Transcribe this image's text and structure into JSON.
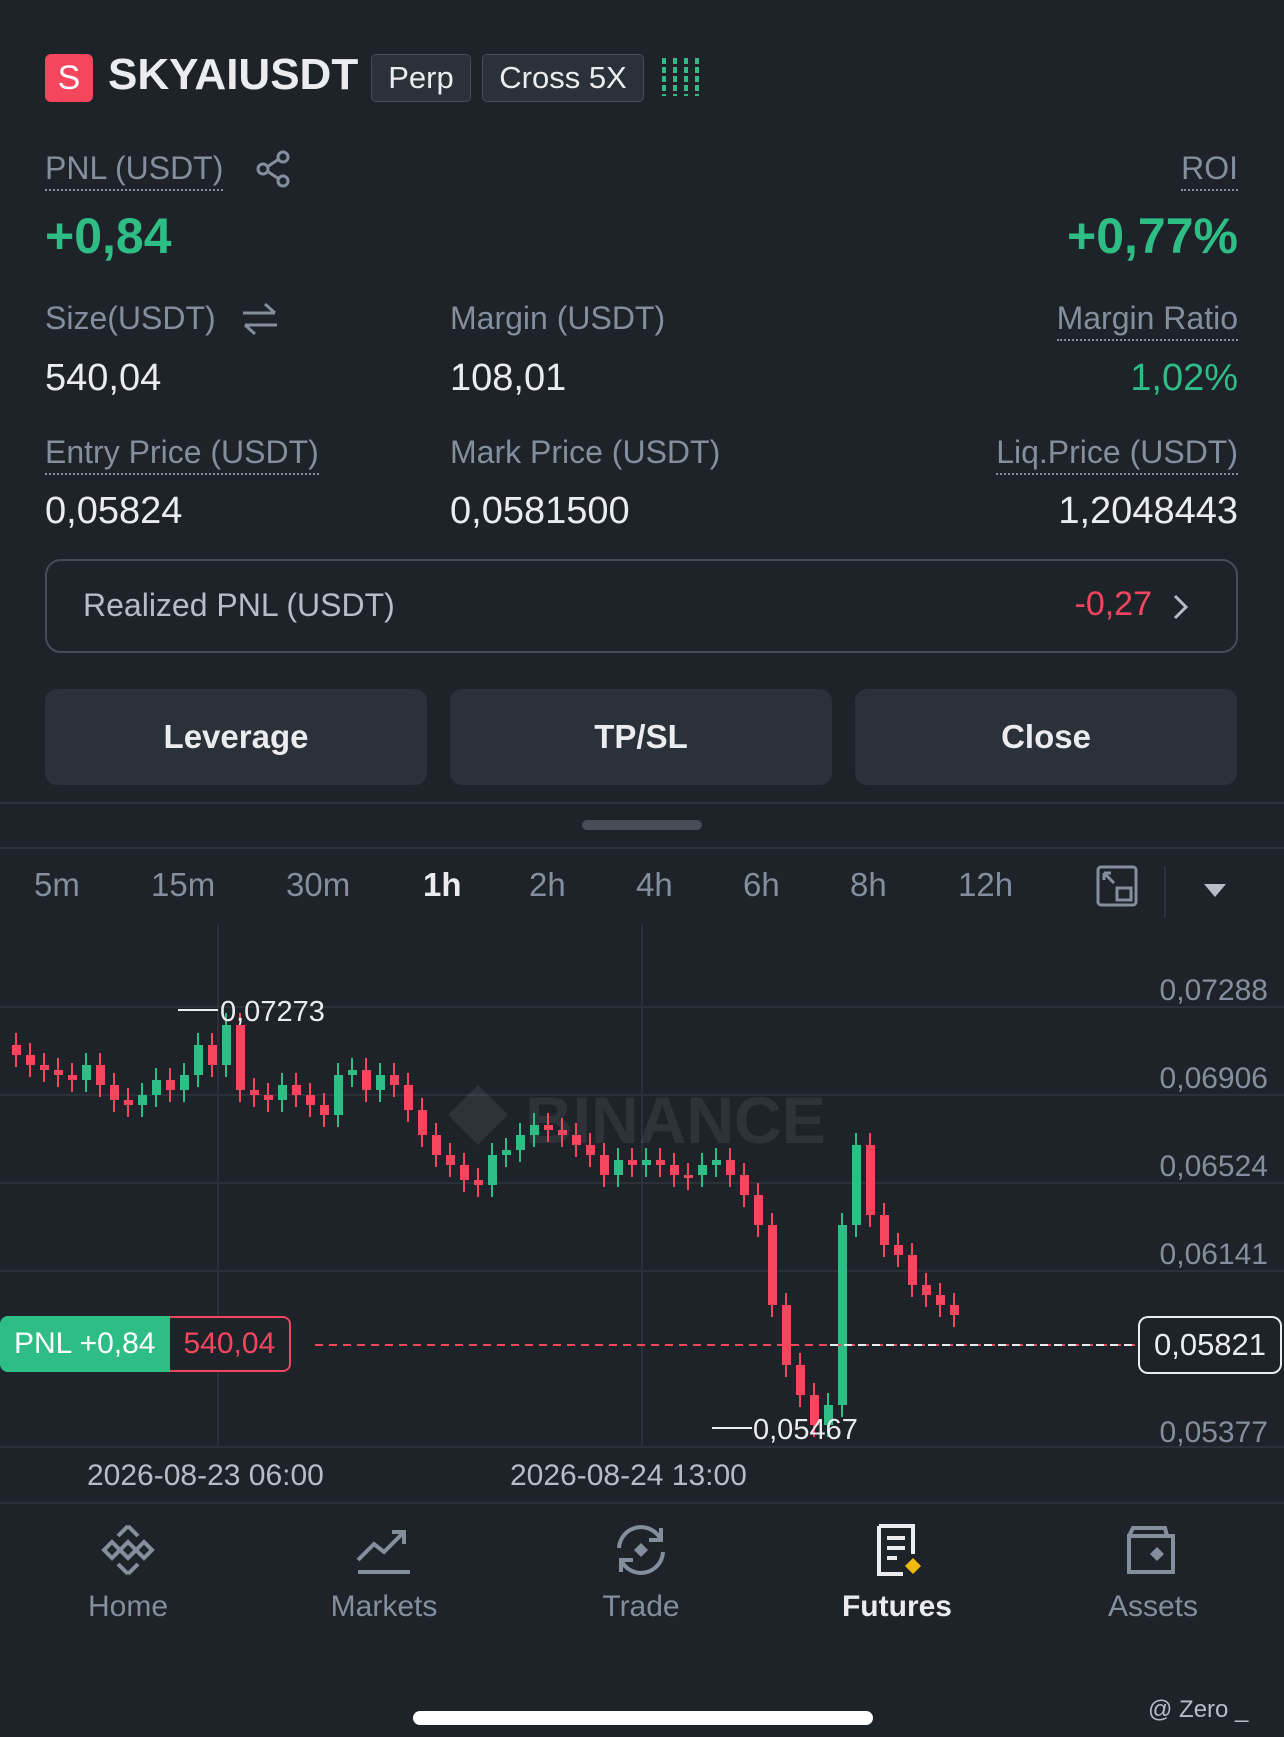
{
  "header": {
    "badge": "S",
    "symbol": "SKYAIUSDT",
    "tag_perp": "Perp",
    "tag_margin": "Cross 5X"
  },
  "pnl": {
    "label": "PNL (USDT)",
    "value": "+0,84"
  },
  "roi": {
    "label": "ROI",
    "value": "+0,77%"
  },
  "size": {
    "label": "Size(USDT)",
    "value": "540,04"
  },
  "margin": {
    "label": "Margin (USDT)",
    "value": "108,01"
  },
  "margin_ratio": {
    "label": "Margin Ratio",
    "value": "1,02%"
  },
  "entry_price": {
    "label": "Entry Price (USDT)",
    "value": "0,05824"
  },
  "mark_price": {
    "label": "Mark Price (USDT)",
    "value": "0,0581500"
  },
  "liq_price": {
    "label": "Liq.Price (USDT)",
    "value": "1,2048443"
  },
  "realized_pnl": {
    "label": "Realized PNL (USDT)",
    "value": "-0,27"
  },
  "actions": {
    "leverage": "Leverage",
    "tpsl": "TP/SL",
    "close": "Close"
  },
  "timeframes": [
    "5m",
    "15m",
    "30m",
    "1h",
    "2h",
    "4h",
    "6h",
    "8h",
    "12h"
  ],
  "active_timeframe": "1h",
  "chart": {
    "y_labels": [
      "0,07288",
      "0,06906",
      "0,06524",
      "0,06141",
      "0,05821",
      "0,05377"
    ],
    "x_labels": [
      "2026-08-23 06:00",
      "2026-08-24 13:00"
    ],
    "high_label": "0,07273",
    "low_label": "0,05467",
    "watermark": "BINANCE",
    "pnl_tag": "PNL +0,84",
    "size_tag": "540,04",
    "current_price": "0,05821"
  },
  "nav": [
    {
      "label": "Home",
      "icon": "binance-logo-icon"
    },
    {
      "label": "Markets",
      "icon": "chart-trend-icon"
    },
    {
      "label": "Trade",
      "icon": "exchange-icon"
    },
    {
      "label": "Futures",
      "icon": "futures-doc-icon"
    },
    {
      "label": "Assets",
      "icon": "wallet-icon"
    }
  ],
  "active_nav": "Futures",
  "credit": "@ Zero _",
  "colors": {
    "bg": "#1e2329",
    "green": "#2ebd85",
    "red": "#f6465d",
    "accent": "#f0b90b"
  }
}
